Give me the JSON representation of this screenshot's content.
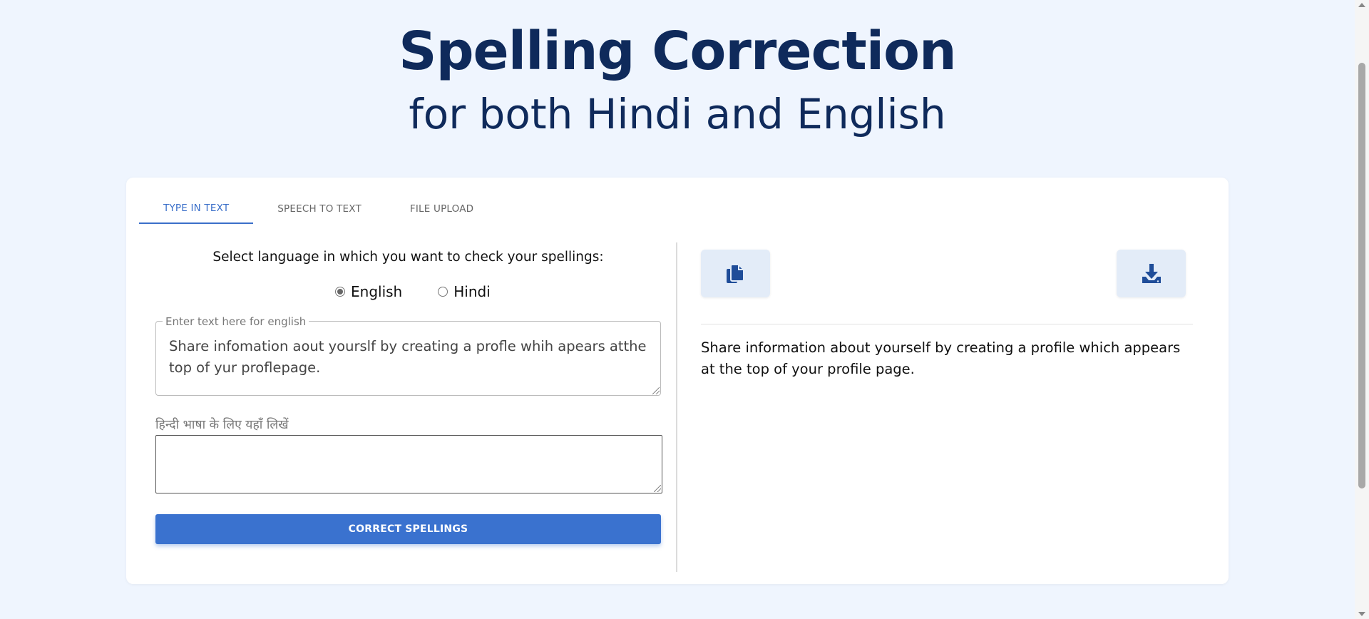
{
  "header": {
    "title": "Spelling Correction",
    "subtitle": "for both Hindi and English"
  },
  "tabs": [
    {
      "label": "TYPE IN TEXT",
      "active": true
    },
    {
      "label": "SPEECH TO TEXT",
      "active": false
    },
    {
      "label": "FILE UPLOAD",
      "active": false
    }
  ],
  "input_panel": {
    "language_prompt": "Select language in which you want to check your spellings:",
    "languages": [
      {
        "label": "English",
        "checked": true
      },
      {
        "label": "Hindi",
        "checked": false
      }
    ],
    "english_field": {
      "legend": "Enter text here for english",
      "value": "Share infomation aout yourslf by creating a profle whih apears atthe top of yur proflepage."
    },
    "hindi_field": {
      "label": "हिन्दी भाषा के लिए यहाँ लिखें",
      "value": ""
    },
    "submit_label": "CORRECT SPELLINGS"
  },
  "output_panel": {
    "copy_icon": "copy-icon",
    "download_icon": "download-icon",
    "result_text": "Share information about yourself by creating a profile which appears at the top of your profile page."
  },
  "colors": {
    "page_bg": "#eff5fe",
    "title": "#0f2a5b",
    "accent": "#3a72cf",
    "icon_bg": "#e3ecf8",
    "icon": "#1f4d99"
  }
}
